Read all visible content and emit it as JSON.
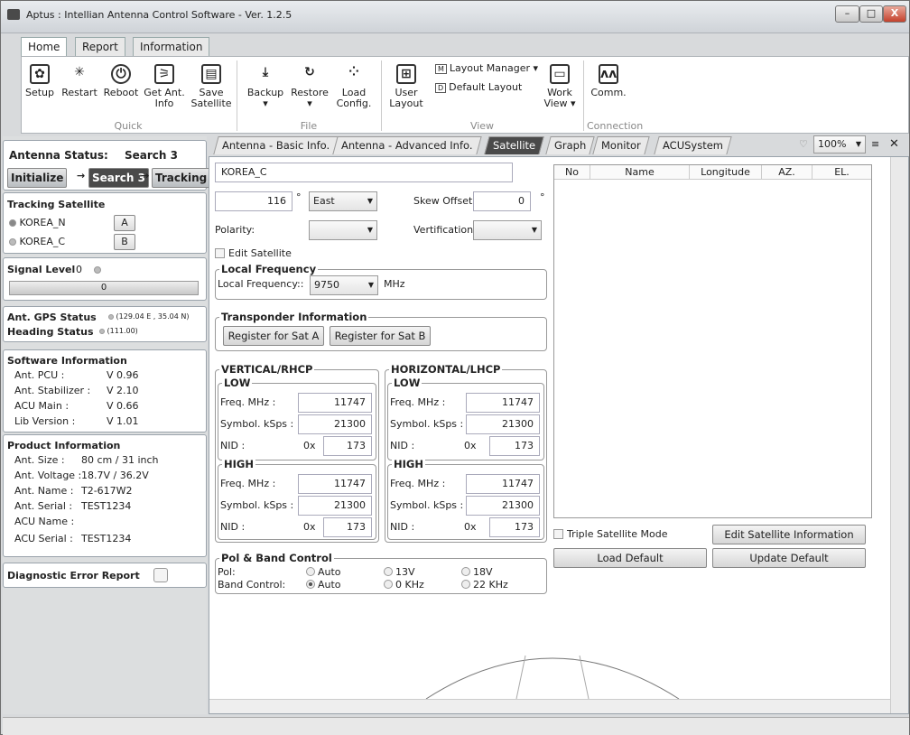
{
  "window": {
    "title": "Aptus : Intellian Antenna Control Software - Ver. 1.2.5",
    "min": "–",
    "max": "□",
    "close": "X"
  },
  "ribbon_tabs": [
    "Home",
    "Report",
    "Information"
  ],
  "ribbon": {
    "setup": "Setup",
    "restart": "Restart",
    "reboot": "Reboot",
    "get_ant_info_1": "Get Ant.",
    "get_ant_info_2": "Info",
    "save_sat_1": "Save",
    "save_sat_2": "Satellite",
    "backup": "Backup",
    "restore": "Restore",
    "load_config_1": "Load",
    "load_config_2": "Config.",
    "user_layout_1": "User",
    "user_layout_2": "Layout",
    "layout_manager": "Layout Manager ▾",
    "default_layout": "Default Layout",
    "work_view_1": "Work",
    "work_view_2": "View ▾",
    "comm": "Comm.",
    "groups": {
      "quick": "Quick",
      "file": "File",
      "view": "View",
      "connection": "Connection"
    }
  },
  "left": {
    "antenna_status_label": "Antenna Status:",
    "antenna_status_value": "Search 3",
    "steps": [
      "Initialize",
      "Search 3",
      "Tracking"
    ],
    "tracking_title": "Tracking Satellite",
    "sat_a_name": "KOREA_N",
    "sat_a_btn": "A",
    "sat_b_name": "KOREA_C",
    "sat_b_btn": "B",
    "signal_label": "Signal Level",
    "signal_value": "0",
    "signal_bar_value": "0",
    "gps_label": "Ant. GPS Status",
    "gps_value": "(129.04 E , 35.04 N)",
    "heading_label": "Heading Status",
    "heading_value": "(111.00)",
    "sw_title": "Software Information",
    "sw_rows": [
      [
        "Ant. PCU :",
        "V 0.96"
      ],
      [
        "Ant. Stabilizer :",
        "V 2.10"
      ],
      [
        "ACU Main :",
        "V 0.66"
      ],
      [
        "Lib Version :",
        "V 1.01"
      ]
    ],
    "prod_title": "Product Information",
    "prod_rows": [
      [
        "Ant. Size :",
        "80 cm / 31 inch"
      ],
      [
        "Ant. Voltage :",
        "18.7V  /  36.2V"
      ],
      [
        "Ant. Name :",
        "T2-617W2"
      ],
      [
        "Ant. Serial :",
        "TEST1234"
      ],
      [
        "ACU Name :",
        ""
      ],
      [
        "ACU Serial :",
        "TEST1234"
      ]
    ],
    "diag_label": "Diagnostic Error Report"
  },
  "tabs": [
    "Antenna - Basic Info.",
    "Antenna - Advanced Info.",
    "Satellite",
    "Graph",
    "Monitor",
    "ACUSystem"
  ],
  "zoom": "100%",
  "satellite": {
    "name": "KOREA_C",
    "longitude": "116",
    "deg": "°",
    "direction": "East",
    "skew_label": "Skew Offset :",
    "skew_value": "0",
    "polarity_label": "Polarity:",
    "verification_label": "Vertification:",
    "edit_satellite": "Edit Satellite",
    "local_freq_title": "Local Frequency",
    "local_freq_label": "Local Frequency::",
    "local_freq_value": "9750",
    "mhz": "MHz",
    "transponder_title": "Transponder Information",
    "reg_a": "Register for Sat A",
    "reg_b": "Register for Sat B",
    "vert_title": "VERTICAL/RHCP",
    "horiz_title": "HORIZONTAL/LHCP",
    "low": "LOW",
    "high": "HIGH",
    "freq_label": "Freq. MHz :",
    "sym_label": "Symbol. kSps :",
    "nid_label": "NID :",
    "ox": "0x",
    "v_low": {
      "freq": "11747",
      "sym": "21300",
      "nid": "173"
    },
    "v_high": {
      "freq": "11747",
      "sym": "21300",
      "nid": "173"
    },
    "h_low": {
      "freq": "11747",
      "sym": "21300",
      "nid": "173"
    },
    "h_high": {
      "freq": "11747",
      "sym": "21300",
      "nid": "173"
    },
    "pol_title": "Pol & Band Control",
    "pol_label": "Pol:",
    "band_label": "Band Control:",
    "pol_opts": [
      "Auto",
      "13V",
      "18V"
    ],
    "band_opts": [
      "Auto",
      "0 KHz",
      "22 KHz"
    ]
  },
  "table": {
    "headers": [
      "No",
      "Name",
      "Longitude",
      "AZ.",
      "EL."
    ]
  },
  "triple_mode": "Triple Satellite Mode",
  "edit_sat_info": "Edit Satellite Information",
  "load_default": "Load Default",
  "update_default": "Update Default"
}
